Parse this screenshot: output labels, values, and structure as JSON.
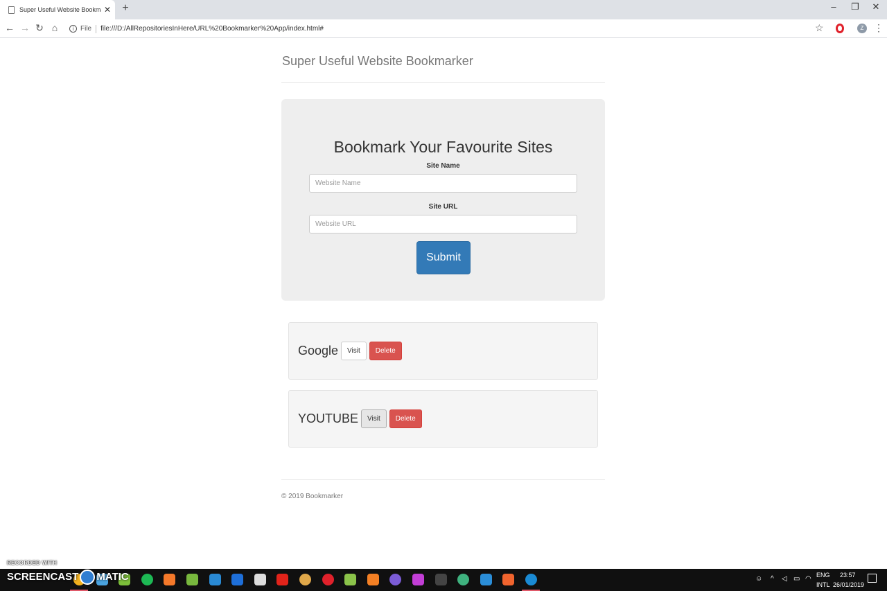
{
  "browser": {
    "tab_title": "Super Useful Website Bookmarker",
    "tab_close": "✕",
    "new_tab": "+",
    "minimize": "–",
    "restore": "❐",
    "close": "✕",
    "back": "←",
    "forward": "→",
    "reload": "↻",
    "home": "⌂",
    "info": "i",
    "scheme": "File",
    "url": "file:///D:/AllRepositoriesInHere/URL%20Bookmarker%20App/index.html#",
    "star": "☆",
    "profile": "Z",
    "menu": "⋮"
  },
  "page": {
    "site_title": "Super Useful Website Bookmarker",
    "heading": "Bookmark Your Favourite Sites",
    "site_name_label": "Site Name",
    "site_name_placeholder": "Website Name",
    "site_url_label": "Site URL",
    "site_url_placeholder": "Website URL",
    "submit_label": "Submit",
    "bookmarks": [
      {
        "name": "Google",
        "visit_label": "Visit",
        "delete_label": "Delete"
      },
      {
        "name": "YOUTUBE",
        "visit_label": "Visit",
        "delete_label": "Delete"
      }
    ],
    "footer": "© 2019 Bookmarker"
  },
  "watermark": {
    "recorded": "RECORDED WITH",
    "brand_left": "SCREENCAST",
    "brand_right": "MATIC"
  },
  "taskbar": {
    "apps": [
      {
        "name": "chrome",
        "color": "#f2b01e"
      },
      {
        "name": "files",
        "color": "#4aa3df"
      },
      {
        "name": "notepad",
        "color": "#7cbf3a"
      },
      {
        "name": "spotify",
        "color": "#1db954"
      },
      {
        "name": "blender",
        "color": "#f5792a"
      },
      {
        "name": "utorrent",
        "color": "#78b83e"
      },
      {
        "name": "media",
        "color": "#2a8ad4"
      },
      {
        "name": "maps",
        "color": "#1e6fd9"
      },
      {
        "name": "unity",
        "color": "#dddddd"
      },
      {
        "name": "pdf",
        "color": "#e2231a"
      },
      {
        "name": "earth",
        "color": "#e0a84a"
      },
      {
        "name": "opera",
        "color": "#e0212b"
      },
      {
        "name": "android",
        "color": "#8bc34a"
      },
      {
        "name": "sublime",
        "color": "#f48024"
      },
      {
        "name": "obs",
        "color": "#7b5cd6"
      },
      {
        "name": "intellij",
        "color": "#c23ed6"
      },
      {
        "name": "terminal",
        "color": "#444444"
      },
      {
        "name": "cube",
        "color": "#3fb27f"
      },
      {
        "name": "vscode",
        "color": "#2b8ed8"
      },
      {
        "name": "postman",
        "color": "#f0642e"
      },
      {
        "name": "recorder",
        "color": "#1a8ad4"
      }
    ],
    "lang_top": "ENG",
    "lang_bottom": "INTL",
    "time": "23:57",
    "date": "26/01/2019"
  }
}
